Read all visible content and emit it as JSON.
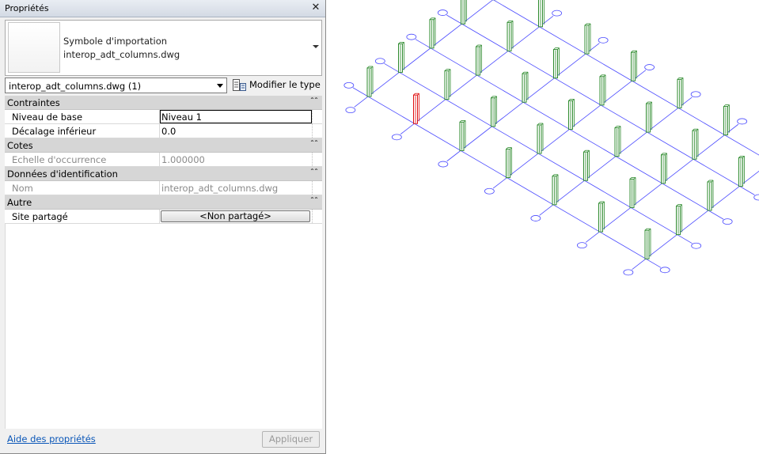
{
  "palette": {
    "grid_line": "#4a4aff",
    "column": "#2e8b2e",
    "column_selected": "#e01010",
    "link": "#0b57b8"
  },
  "panel": {
    "title": "Propriétés",
    "close_glyph": "✕",
    "type_selector": {
      "family": "Symbole d'importation",
      "name": "interop_adt_columns.dwg"
    },
    "instance_filter": "interop_adt_columns.dwg (1)",
    "edit_type_label": "Modifier le type",
    "groups": [
      {
        "name": "Contraintes",
        "rows": [
          {
            "label": "Niveau de base",
            "value": "Niveau 1"
          },
          {
            "label": "Décalage inférieur",
            "value": "0.0"
          }
        ]
      },
      {
        "name": "Cotes",
        "rows": [
          {
            "label": "Echelle d'occurrence",
            "value": "1.000000"
          }
        ]
      },
      {
        "name": "Données d'identification",
        "rows": [
          {
            "label": "Nom",
            "value": "interop_adt_columns.dwg"
          }
        ]
      },
      {
        "name": "Autre",
        "rows": [
          {
            "label": "Site partagé",
            "value": "<Non partagé>"
          }
        ]
      }
    ],
    "help_link": "Aide des propriétés",
    "apply_button": "Appliquer"
  },
  "viewport": {
    "description_icon": "isometric-column-grid",
    "grid": {
      "rows": 5,
      "cols": 7
    },
    "selected_column": {
      "row": 0,
      "col": 1
    }
  }
}
